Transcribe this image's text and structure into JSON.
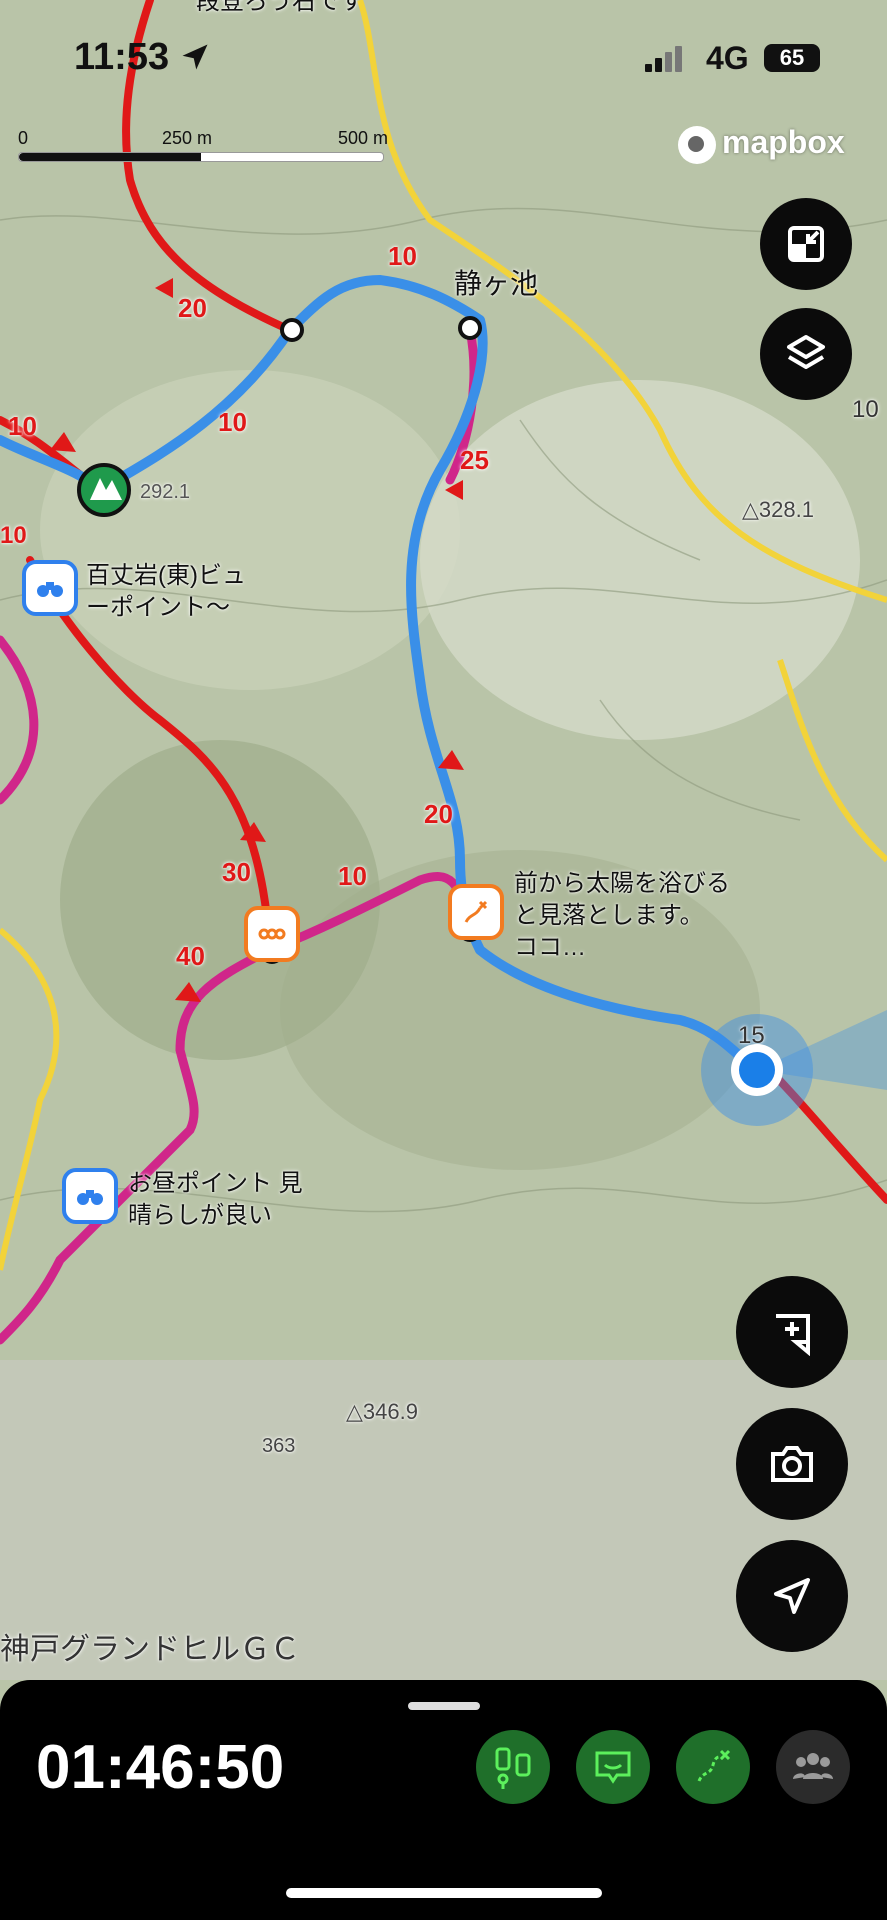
{
  "status_bar": {
    "time": "11:53",
    "network": "4G",
    "battery": "65",
    "location_icon": "location-arrow-icon"
  },
  "scale": {
    "zero": "0",
    "mid": "250 m",
    "max": "500 m"
  },
  "attribution": "mapbox",
  "map": {
    "labels": {
      "pond": "静ヶ池",
      "viewpoint_east_1": "百丈岩(東)ビュ",
      "viewpoint_east_2": "ーポイント〜",
      "note_1": "前から太陽を浴びる",
      "note_2": "と見落とします。",
      "note_3": "ココ…",
      "lunch_1": "お昼ポイント 見",
      "lunch_2": "晴らしが良い",
      "elev_328": "△328.1",
      "elev_346": "△346.9",
      "elev_363": "363",
      "elev_292": "292.1",
      "golf": "神戸グランドヒルＧＣ",
      "clipped_top": "段登ろう右です"
    },
    "segment_times": [
      "10",
      "20",
      "10",
      "10",
      "25",
      "20",
      "30",
      "10",
      "40",
      "15",
      "10",
      "10"
    ],
    "colors": {
      "blue_route": "#3a8fe8",
      "red_trail": "#e01818",
      "magenta_trail": "#d0268a",
      "yellow_road": "#f2d33a",
      "terrain": "#b9c4a8"
    }
  },
  "controls": [
    {
      "icon": "fullscreen-exit-icon"
    },
    {
      "icon": "layers-icon"
    },
    {
      "icon": "add-note-icon"
    },
    {
      "icon": "camera-icon"
    },
    {
      "icon": "navigate-icon"
    }
  ],
  "bottom": {
    "elapsed": "01:46:50",
    "chips": [
      {
        "icon": "distance-gauge-icon"
      },
      {
        "icon": "message-icon"
      },
      {
        "icon": "route-icon"
      },
      {
        "icon": "group-icon"
      }
    ]
  }
}
